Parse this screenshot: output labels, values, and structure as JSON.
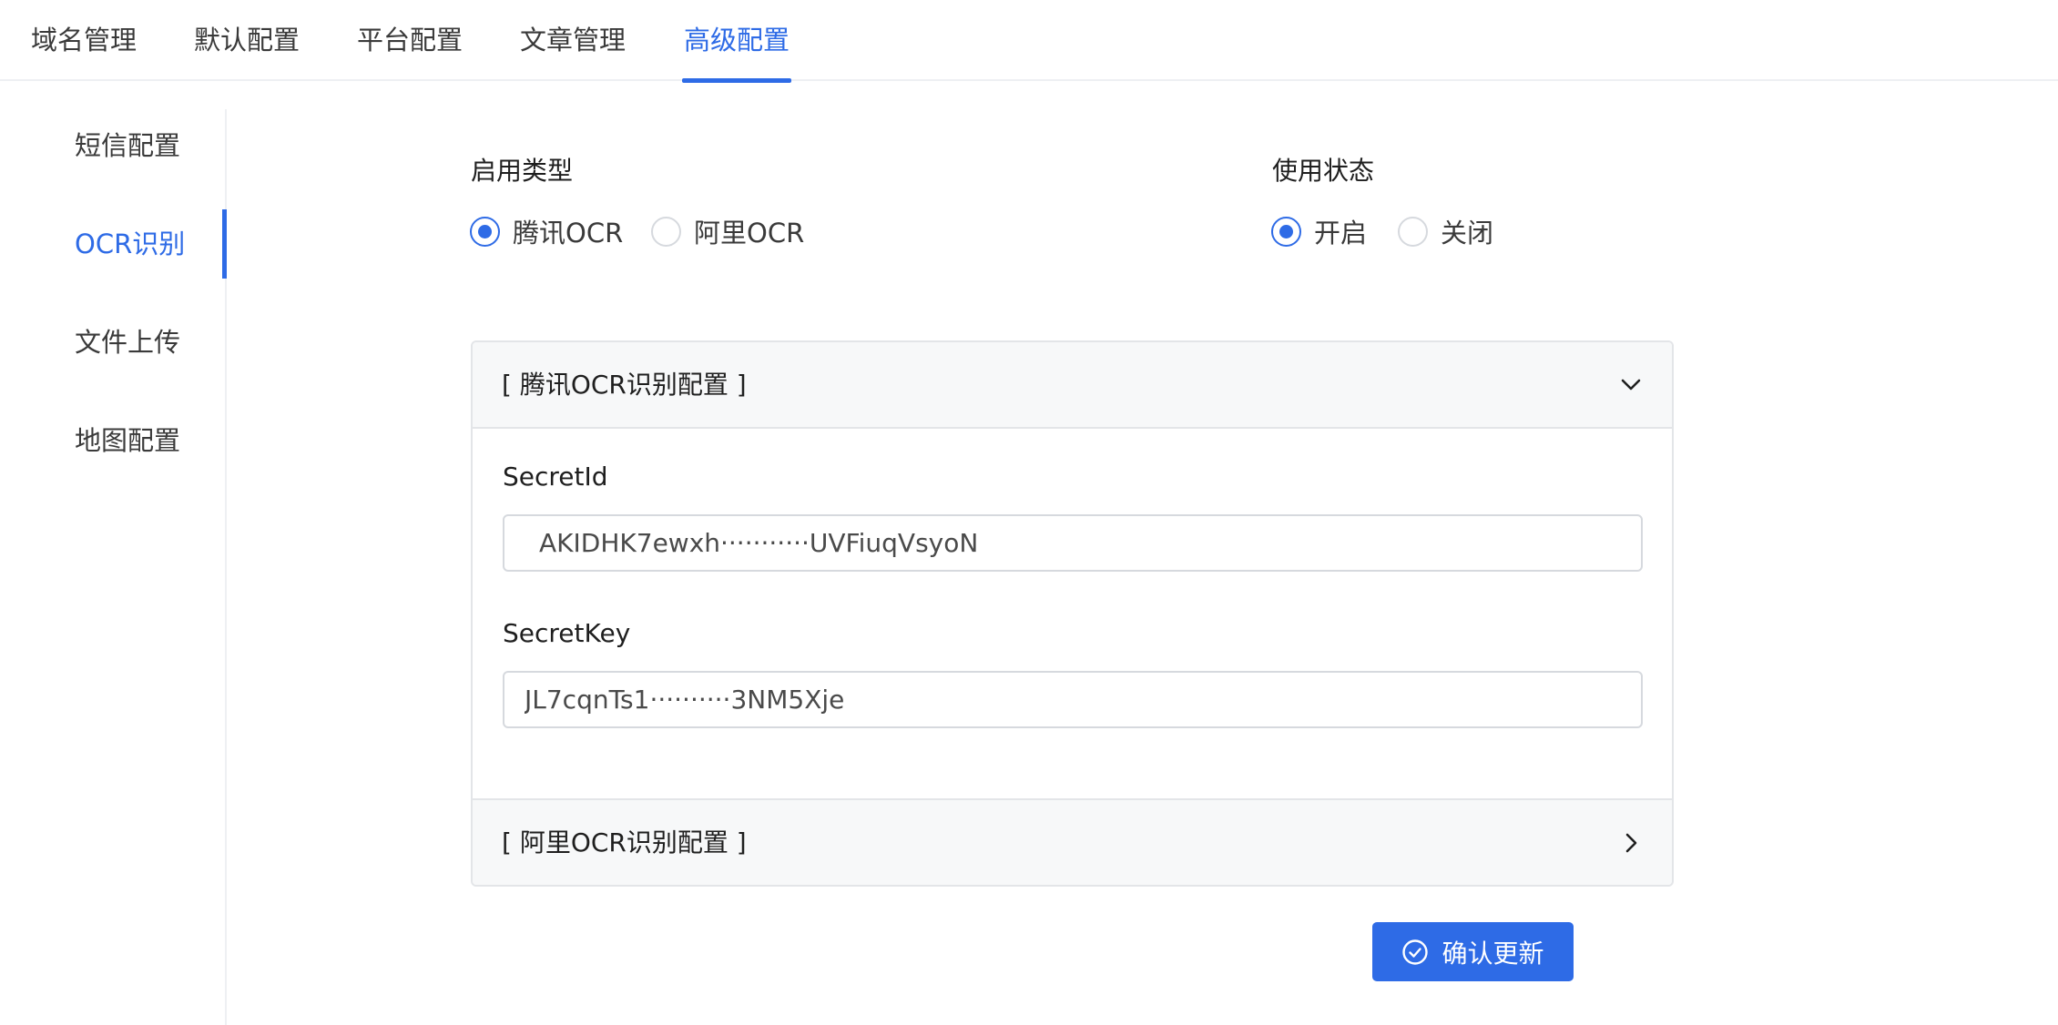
{
  "top_tabs": [
    {
      "label": "域名管理",
      "active": false
    },
    {
      "label": "默认配置",
      "active": false
    },
    {
      "label": "平台配置",
      "active": false
    },
    {
      "label": "文章管理",
      "active": false
    },
    {
      "label": "高级配置",
      "active": true
    }
  ],
  "side_nav": {
    "items": [
      {
        "label": "短信配置",
        "active": false
      },
      {
        "label": "OCR识别",
        "active": true
      },
      {
        "label": "文件上传",
        "active": false
      },
      {
        "label": "地图配置",
        "active": false
      }
    ]
  },
  "form": {
    "enable_type": {
      "label": "启用类型",
      "options": [
        "腾讯OCR",
        "阿里OCR"
      ],
      "selected": "腾讯OCR"
    },
    "status": {
      "label": "使用状态",
      "options": [
        "开启",
        "关闭"
      ],
      "selected": "开启"
    }
  },
  "panels": {
    "tencent": {
      "title": "[ 腾讯OCR识别配置 ]",
      "expanded": true,
      "secret_id_label": "SecretId",
      "secret_id_value": "AKIDHK7ewxh···········UVFiuqVsyoN",
      "secret_key_label": "SecretKey",
      "secret_key_value": "JL7cqnTs1··········3NM5Xje"
    },
    "aliyun": {
      "title": "[ 阿里OCR识别配置 ]",
      "expanded": false
    }
  },
  "submit_button": {
    "label": "确认更新",
    "icon": "check-circle-icon"
  },
  "colors": {
    "accent": "#2e6be6",
    "border": "#e3e5e8",
    "header_bg": "#f7f8f9"
  }
}
